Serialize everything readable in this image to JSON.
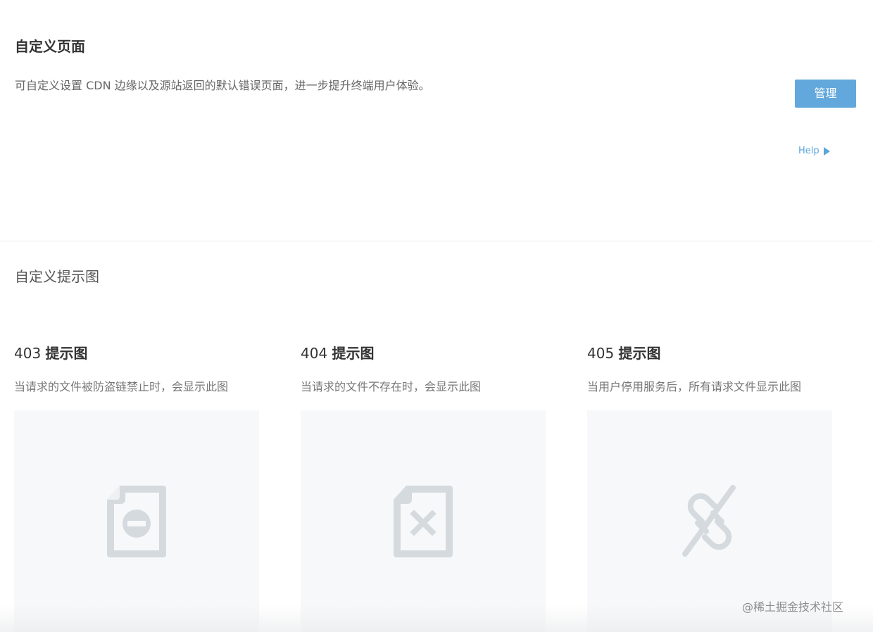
{
  "header": {
    "title": "自定义页面",
    "description": "可自定义设置 CDN 边缘以及源站返回的默认错误页面，进一步提升终端用户体验。",
    "manage_label": "管理",
    "help_label": "Help"
  },
  "section": {
    "subtitle": "自定义提示图"
  },
  "cards": [
    {
      "code": "403",
      "label": "提示图",
      "description": "当请求的文件被防盗链禁止时，会显示此图",
      "icon": "file-blocked-icon"
    },
    {
      "code": "404",
      "label": "提示图",
      "description": "当请求的文件不存在时，会显示此图",
      "icon": "file-missing-icon"
    },
    {
      "code": "405",
      "label": "提示图",
      "description": "当用户停用服务后，所有请求文件显示此图",
      "icon": "broken-link-icon"
    }
  ],
  "watermark": "@稀土掘金技术社区",
  "colors": {
    "accent": "#62a8dc",
    "link": "#5aa5d9",
    "icon_gray": "#d5dadf",
    "image_bg": "#f7f8f9"
  }
}
